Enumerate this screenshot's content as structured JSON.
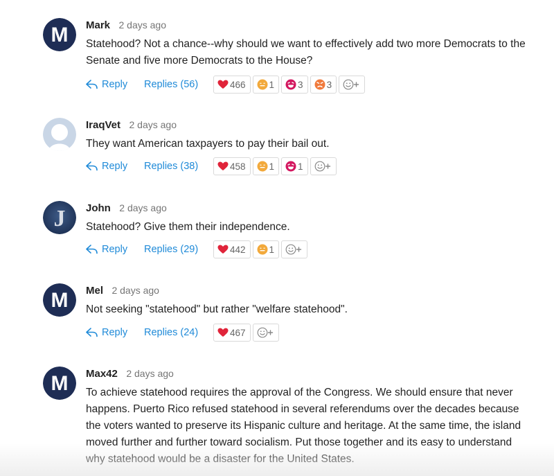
{
  "comments": [
    {
      "author": "Mark",
      "time": "2 days ago",
      "avatar": {
        "type": "letter",
        "letter": "M",
        "color": "#1e2d55"
      },
      "text": "Statehood? Not a chance--why should we want to effectively add two more Democrats to the Senate and five more Democrats to the House?",
      "reply_label": "Reply",
      "replies_label": "Replies (56)",
      "reactions": {
        "heart": "466",
        "meh": "1",
        "laugh": "3",
        "angry": "3"
      }
    },
    {
      "author": "IraqVet",
      "time": "2 days ago",
      "avatar": {
        "type": "silhouette",
        "color": "#c9d6e6"
      },
      "text": "They want American taxpayers to pay their bail out.",
      "reply_label": "Reply",
      "replies_label": "Replies (38)",
      "reactions": {
        "heart": "458",
        "meh": "1",
        "laugh": "1"
      }
    },
    {
      "author": "John",
      "time": "2 days ago",
      "avatar": {
        "type": "letter",
        "letter": "J",
        "color": "#263d63"
      },
      "text": "Statehood? Give them their independence.",
      "reply_label": "Reply",
      "replies_label": "Replies (29)",
      "reactions": {
        "heart": "442",
        "meh": "1"
      }
    },
    {
      "author": "Mel",
      "time": "2 days ago",
      "avatar": {
        "type": "letter",
        "letter": "M",
        "color": "#1e2d55"
      },
      "text": "Not seeking \"statehood\" but rather \"welfare statehood\".",
      "reply_label": "Reply",
      "replies_label": "Replies (24)",
      "reactions": {
        "heart": "467"
      }
    },
    {
      "author": "Max42",
      "time": "2 days ago",
      "avatar": {
        "type": "letter",
        "letter": "M",
        "color": "#1e2d55"
      },
      "text": "To achieve statehood requires the approval of the Congress. We should ensure that never happens. Puerto Rico refused statehood in several referendums over the decades because the voters wanted to preserve its Hispanic culture and heritage. At the same time, the island moved further and further toward socialism. Put those together and its easy to understand why statehood would be a disaster for the United States."
    }
  ],
  "colors": {
    "link": "#1f8ad8",
    "heart": "#e0243a",
    "meh": "#f2a93b",
    "laugh": "#d3175f",
    "angry": "#f07a3c"
  },
  "icons": [
    "reply-arrow-icon",
    "heart-icon",
    "meh-face-icon",
    "laugh-face-icon",
    "angry-face-icon",
    "add-reaction-icon"
  ]
}
